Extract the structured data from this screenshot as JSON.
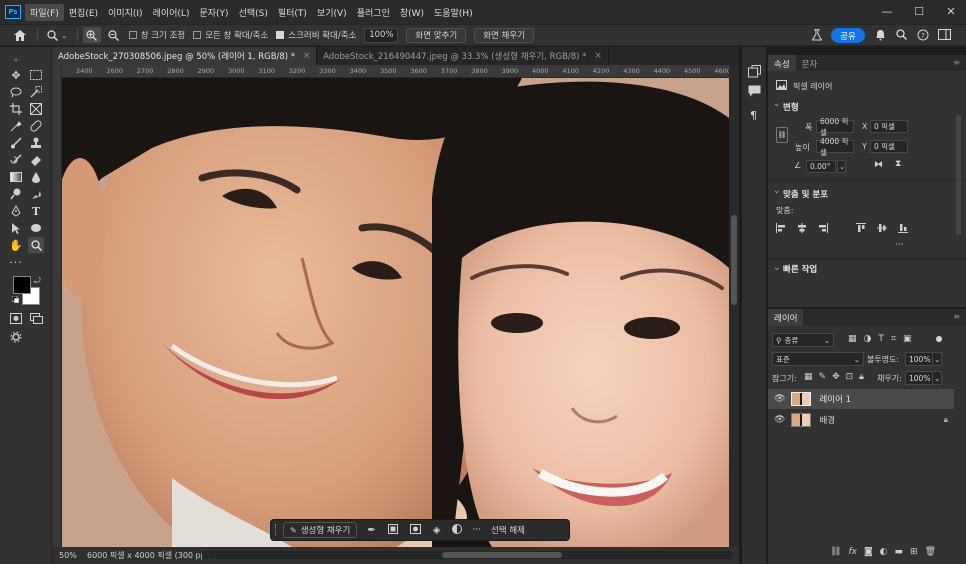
{
  "app": {
    "logo": "Ps"
  },
  "menus": [
    "파일(F)",
    "편집(E)",
    "이미지(I)",
    "레이어(L)",
    "문자(Y)",
    "선택(S)",
    "필터(T)",
    "보기(V)",
    "플러그인",
    "창(W)",
    "도움말(H)"
  ],
  "window_controls": {
    "minimize": "—",
    "maximize": "☐",
    "close": "✕"
  },
  "options": {
    "resize_windows": "창 크기 조정",
    "zoom_all": "모든 창 확대/축소",
    "scrubby_zoom": "스크러비 확대/축소",
    "zoom_value": "100%",
    "fit_screen": "화면 맞추기",
    "fill_screen": "화면 채우기",
    "share": "공유"
  },
  "tabs": [
    {
      "label": "AdobeStock_270308506.jpeg @ 50% (레이어 1, RGB/8) *",
      "close": "×"
    },
    {
      "label": "AdobeStock_216490447.jpeg @ 33.3% (생성형 채우기, RGB/8) *",
      "close": "×"
    }
  ],
  "ruler": {
    "ticks": [
      "2400",
      "2600",
      "2700",
      "2800",
      "2900",
      "3000",
      "3100",
      "3200",
      "3300",
      "3400",
      "3500",
      "3600",
      "3700",
      "3800",
      "3900",
      "4000",
      "4100",
      "4200",
      "4300",
      "4400",
      "4500",
      "4600"
    ]
  },
  "status": {
    "zoom": "50%",
    "info": "6000 픽셀 x 4000 픽셀 (300 ppi)",
    "arrow": "›"
  },
  "context_bar": {
    "generative_fill": "생성형 채우기",
    "deselect": "선택 해제",
    "more": "···"
  },
  "properties": {
    "tabs": [
      "속성",
      "문자"
    ],
    "layer_type": "픽셀 레이어",
    "transform_title": "변형",
    "width_label": "폭",
    "width_value": "6000 픽셀",
    "height_label": "높이",
    "height_value": "4000 픽셀",
    "x_label": "X",
    "x_value": "0 픽셀",
    "y_label": "Y",
    "y_value": "0 픽셀",
    "angle_value": "0.00°",
    "align_title": "맞춤 및 분포",
    "align_label": "맞춤:",
    "quick_actions": "빠른 작업",
    "more": "···"
  },
  "layers_panel": {
    "tab": "레이어",
    "filter": "종류",
    "blend_mode": "표준",
    "opacity_label": "불투명도:",
    "opacity_value": "100%",
    "lock_label": "잠그기:",
    "fill_label": "채우기:",
    "fill_value": "100%",
    "layers": [
      {
        "name": "레이어 1",
        "selected": true
      },
      {
        "name": "배경",
        "selected": false
      }
    ]
  },
  "colors": {
    "accent": "#1473e6",
    "panel": "#323232",
    "dark": "#1e1e1e"
  }
}
